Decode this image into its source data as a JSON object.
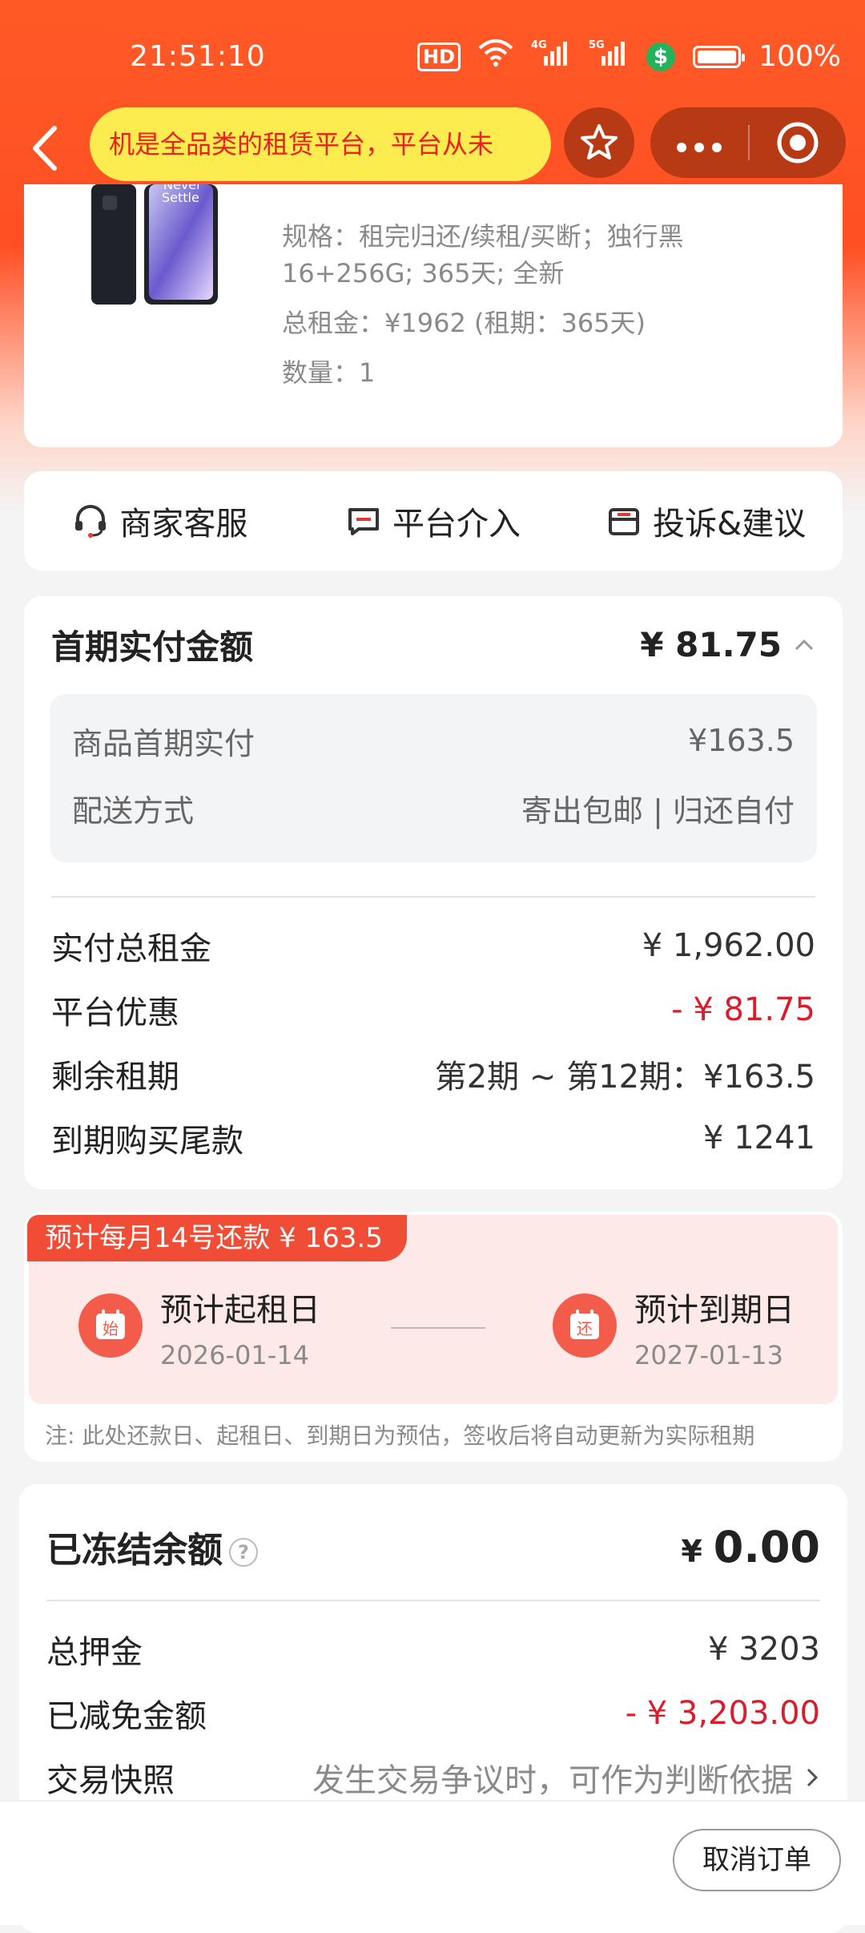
{
  "status_bar": {
    "time": "21:51:10",
    "hd": "HD",
    "net1": "4G",
    "net2": "5G",
    "battery_pct": "100%",
    "icons": [
      "hd-icon",
      "wifi-icon",
      "signal-icon",
      "signal-icon",
      "dollar-icon",
      "battery-icon"
    ]
  },
  "nav": {
    "search_text": "机是全品类的租赁平台，平台从未",
    "accent": "#ff5a26",
    "pill_color": "#fcec4f"
  },
  "product": {
    "image_text": [
      "Never",
      "Settle"
    ],
    "spec_line1": "规格：租完归还/续租/买断；独行黑",
    "spec_line2": "16+256G; 365天; 全新",
    "total_rent": "总租金：¥1962 (租期：365天)",
    "quantity": "数量：1"
  },
  "actions": [
    {
      "label": "商家客服",
      "icon": "headset-icon"
    },
    {
      "label": "平台介入",
      "icon": "message-icon"
    },
    {
      "label": "投诉&建议",
      "icon": "mail-icon"
    }
  ],
  "first_payment": {
    "title": "首期实付金额",
    "amount": "¥ 81.75",
    "details": [
      {
        "label": "商品首期实付",
        "value": "¥163.5"
      },
      {
        "label": "配送方式",
        "value": "寄出包邮 | 归还自付"
      }
    ],
    "rows": [
      {
        "label": "实付总租金",
        "value": "¥ 1,962.00"
      },
      {
        "label": "平台优惠",
        "value": "- ¥ 81.75"
      },
      {
        "label": "剩余租期",
        "value": "第2期 ~ 第12期：¥163.5"
      },
      {
        "label": "到期购买尾款",
        "value": "¥ 1241"
      }
    ]
  },
  "schedule": {
    "tag": "预计每月14号还款 ¥ 163.5",
    "start_icon_char": "始",
    "start_title": "预计起租日",
    "start_date": "2026-01-14",
    "end_icon_char": "还",
    "end_title": "预计到期日",
    "end_date": "2027-01-13",
    "note": "注: 此处还款日、起租日、到期日为预估，签收后将自动更新为实际租期"
  },
  "frozen": {
    "title": "已冻结余额",
    "currency": "¥",
    "amount": "0.00",
    "rows": [
      {
        "label": "总押金",
        "value": "¥ 3203"
      },
      {
        "label": "已减免金额",
        "value": "- ¥ 3,203.00"
      },
      {
        "label": "交易快照",
        "value": "发生交易争议时，可作为判断依据"
      }
    ]
  },
  "bottom": {
    "cancel_label": "取消订单"
  },
  "colors": {
    "discount_red": "#d81e2c",
    "tag_red": "#f04c36"
  }
}
